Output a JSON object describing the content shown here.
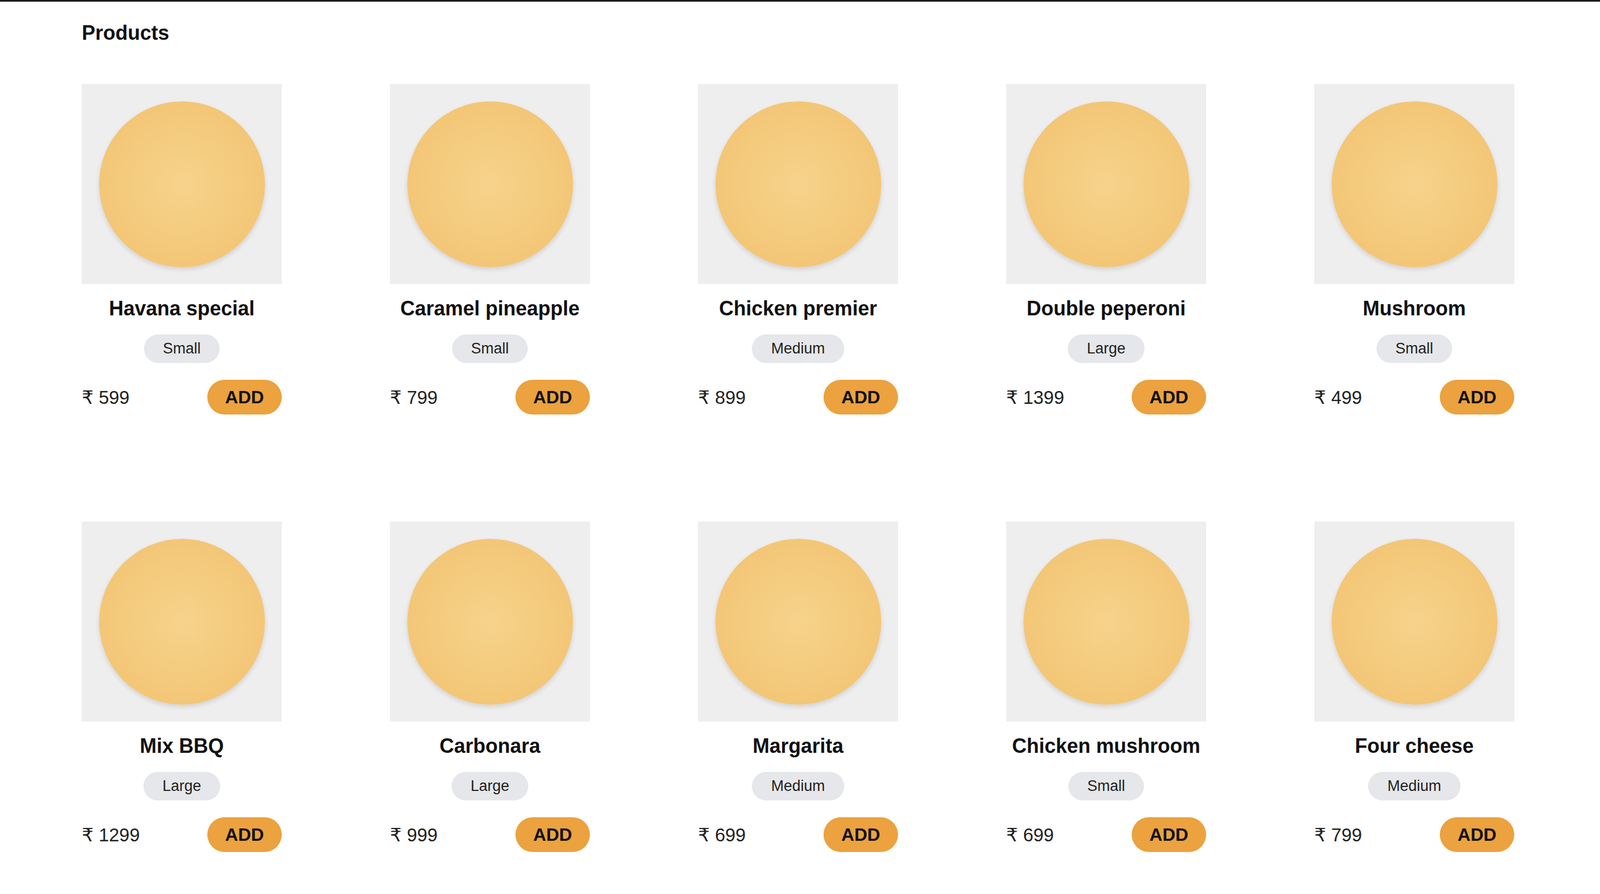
{
  "page": {
    "heading": "Products"
  },
  "products": [
    {
      "name": "Havana special",
      "size": "Small",
      "price": "₹ 599",
      "action": "ADD"
    },
    {
      "name": "Caramel pineapple",
      "size": "Small",
      "price": "₹ 799",
      "action": "ADD"
    },
    {
      "name": "Chicken premier",
      "size": "Medium",
      "price": "₹ 899",
      "action": "ADD"
    },
    {
      "name": "Double peperoni",
      "size": "Large",
      "price": "₹ 1399",
      "action": "ADD"
    },
    {
      "name": "Mushroom",
      "size": "Small",
      "price": "₹ 499",
      "action": "ADD"
    },
    {
      "name": "Mix BBQ",
      "size": "Large",
      "price": "₹ 1299",
      "action": "ADD"
    },
    {
      "name": "Carbonara",
      "size": "Large",
      "price": "₹ 999",
      "action": "ADD"
    },
    {
      "name": "Margarita",
      "size": "Medium",
      "price": "₹ 699",
      "action": "ADD"
    },
    {
      "name": "Chicken mushroom",
      "size": "Small",
      "price": "₹ 699",
      "action": "ADD"
    },
    {
      "name": "Four cheese",
      "size": "Medium",
      "price": "₹ 799",
      "action": "ADD"
    }
  ]
}
